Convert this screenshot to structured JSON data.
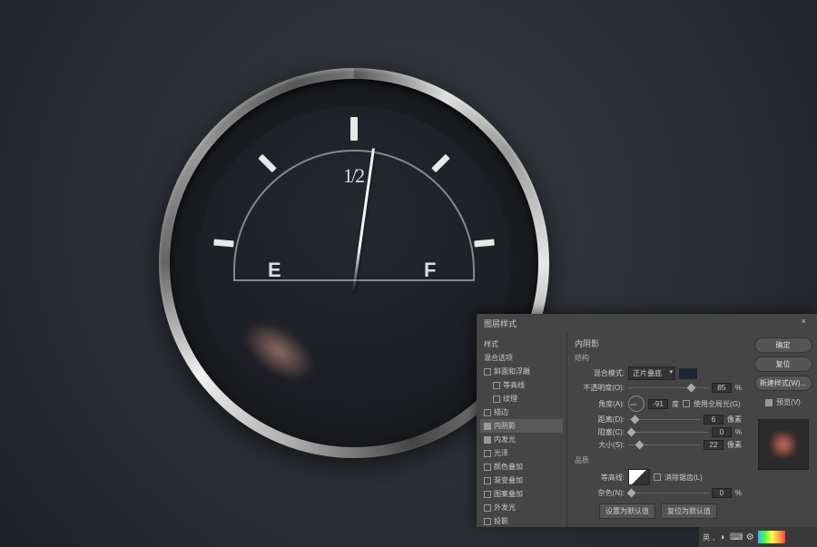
{
  "gauge": {
    "half_label": "1/2",
    "empty_label": "E",
    "full_label": "F"
  },
  "dialog": {
    "title": "图层样式",
    "close": "×",
    "left": {
      "styles_header": "样式",
      "blend_options": "混合选项",
      "items": [
        {
          "label": "斜面和浮雕",
          "checked": false
        },
        {
          "label": "等高线",
          "checked": false
        },
        {
          "label": "纹理",
          "checked": false
        },
        {
          "label": "描边",
          "checked": false
        },
        {
          "label": "内阴影",
          "checked": true,
          "selected": true
        },
        {
          "label": "内发光",
          "checked": true
        },
        {
          "label": "光泽",
          "checked": false
        },
        {
          "label": "颜色叠加",
          "checked": false
        },
        {
          "label": "渐变叠加",
          "checked": false
        },
        {
          "label": "图案叠加",
          "checked": false
        },
        {
          "label": "外发光",
          "checked": false
        },
        {
          "label": "投影",
          "checked": false
        }
      ]
    },
    "mid": {
      "section": "内阴影",
      "structure": "结构",
      "blend_mode_label": "混合模式:",
      "blend_mode_value": "正片叠底",
      "opacity_label": "不透明度(O):",
      "opacity_value": "85",
      "opacity_unit": "%",
      "angle_label": "角度(A):",
      "angle_value": "-91",
      "angle_unit": "度",
      "global_light": "使用全局光(G)",
      "distance_label": "距离(D):",
      "distance_value": "6",
      "distance_unit": "像素",
      "choke_label": "阻塞(C):",
      "choke_value": "0",
      "choke_unit": "%",
      "size_label": "大小(S):",
      "size_value": "22",
      "size_unit": "像素",
      "quality": "品质",
      "contour_label": "等高线:",
      "antialias": "消除锯齿(L)",
      "noise_label": "杂色(N):",
      "noise_value": "0",
      "noise_unit": "%",
      "make_default": "设置为默认值",
      "reset_default": "复位为默认值"
    },
    "right": {
      "ok": "确定",
      "cancel": "复位",
      "new_style": "新建样式(W)...",
      "preview_label": "预览(V)"
    }
  },
  "taskbar": {
    "ime": "英",
    "comma": ","
  }
}
